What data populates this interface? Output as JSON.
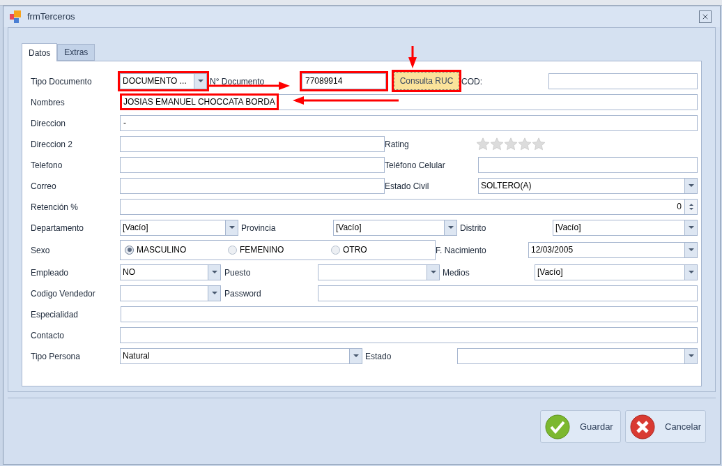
{
  "window": {
    "title": "frmTerceros"
  },
  "tabs": [
    {
      "label": "Datos",
      "selected": true
    },
    {
      "label": "Extras",
      "selected": false
    }
  ],
  "rows": [
    [
      {
        "kind": "label",
        "text": "Tipo Documento"
      },
      {
        "kind": "combo",
        "value": "DOCUMENTO ...",
        "highlighted": true
      },
      {
        "kind": "label",
        "text": "N° Documento"
      },
      {
        "kind": "text",
        "value": "77089914",
        "highlighted": true
      },
      {
        "kind": "button",
        "text": "Consulta RUC",
        "highlighted": true
      },
      {
        "kind": "label",
        "text": "COD:"
      },
      {
        "kind": "text"
      }
    ],
    [
      {
        "kind": "label",
        "text": "Nombres"
      },
      {
        "kind": "text",
        "value": "JOSIAS EMANUEL CHOCCATA BORDA",
        "highlighted": true
      }
    ],
    [
      {
        "kind": "label",
        "text": "Direccion"
      },
      {
        "kind": "text",
        "value": "-"
      }
    ],
    [
      {
        "kind": "label",
        "text": "Direccion 2"
      },
      {
        "kind": "text"
      },
      {
        "kind": "label",
        "text": "Rating"
      },
      {
        "kind": "stars",
        "stars": 0
      }
    ],
    [
      {
        "kind": "label",
        "text": "Telefono"
      },
      {
        "kind": "text"
      },
      {
        "kind": "label",
        "text": "Teléfono Celular"
      },
      {
        "kind": "text"
      }
    ],
    [
      {
        "kind": "label",
        "text": "Correo"
      },
      {
        "kind": "text"
      },
      {
        "kind": "label",
        "text": "Estado Civil"
      },
      {
        "kind": "combo",
        "value": "SOLTERO(A)"
      }
    ],
    [
      {
        "kind": "label",
        "text": "Retención %"
      },
      {
        "kind": "spin",
        "value": "0"
      }
    ],
    [
      {
        "kind": "label",
        "text": "Departamento"
      },
      {
        "kind": "combo",
        "value": "[Vacío]"
      },
      {
        "kind": "label",
        "text": "Provincia"
      },
      {
        "kind": "combo",
        "value": "[Vacío]"
      },
      {
        "kind": "label",
        "text": "Distrito"
      },
      {
        "kind": "combo",
        "value": "[Vacío]"
      }
    ],
    [
      {
        "kind": "label",
        "text": "Sexo"
      },
      {
        "kind": "radios",
        "options": [
          {
            "label": "MASCULINO",
            "selected": true
          },
          {
            "label": "FEMENINO",
            "selected": false
          },
          {
            "label": "OTRO",
            "selected": false
          }
        ]
      },
      {
        "kind": "label",
        "text": "F. Nacimiento"
      },
      {
        "kind": "combo",
        "value": "12/03/2005"
      }
    ],
    [
      {
        "kind": "label",
        "text": "Empleado"
      },
      {
        "kind": "combo",
        "value": "NO"
      },
      {
        "kind": "label",
        "text": "Puesto"
      },
      {
        "kind": "combo"
      },
      {
        "kind": "label",
        "text": "Medios"
      },
      {
        "kind": "combo",
        "value": "[Vacío]"
      }
    ],
    [
      {
        "kind": "label",
        "text": "Codigo Vendedor"
      },
      {
        "kind": "combo"
      },
      {
        "kind": "label",
        "text": "Password"
      },
      {
        "kind": "text"
      }
    ],
    [
      {
        "kind": "label",
        "text": "Especialidad"
      },
      {
        "kind": "text"
      }
    ],
    [
      {
        "kind": "label",
        "text": "Contacto"
      },
      {
        "kind": "text"
      }
    ],
    [
      {
        "kind": "label",
        "text": "Tipo Persona"
      },
      {
        "kind": "combo",
        "value": "Natural"
      },
      {
        "kind": "label",
        "text": "Estado"
      },
      {
        "kind": "combo"
      }
    ]
  ],
  "buttons": [
    {
      "kind": "save",
      "label": "Guardar"
    },
    {
      "kind": "cancel",
      "label": "Cancelar"
    }
  ]
}
